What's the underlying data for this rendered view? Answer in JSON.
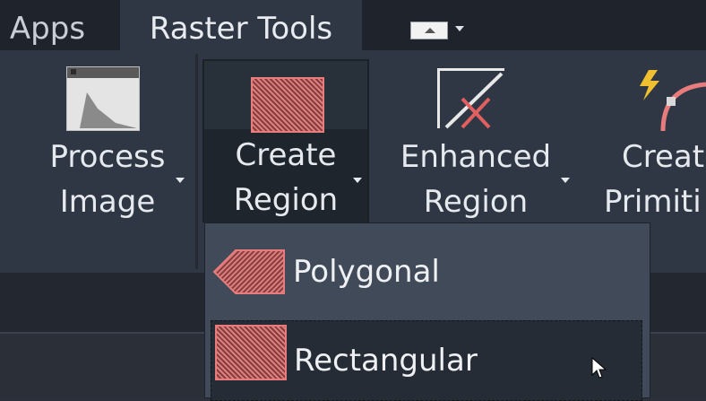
{
  "tabs": [
    {
      "label": "Apps",
      "active": false
    },
    {
      "label": "Raster Tools",
      "active": true
    }
  ],
  "quick_access": {
    "icon": "eject-dropdown-icon"
  },
  "ribbon": {
    "process_image": {
      "line1": "Process",
      "line2": "Image",
      "icon": "histogram-icon"
    },
    "create_region": {
      "line1": "Create",
      "line2": "Region",
      "icon": "region-fill-icon"
    },
    "enhanced_region": {
      "line1": "Enhanced",
      "line2": "Region",
      "icon": "enhanced-region-icon"
    },
    "create_primitive": {
      "line1": "Creat",
      "line2": "Primiti",
      "icon": "create-primitive-icon"
    }
  },
  "dropdown": {
    "items": [
      {
        "label": "Polygonal",
        "icon": "polygon-region-icon"
      },
      {
        "label": "Rectangular",
        "icon": "rectangle-region-icon",
        "hovered": true
      }
    ]
  },
  "colors": {
    "tabbar": "#1f242c",
    "ribbon": "#2f3744",
    "region_fill": "#b05050",
    "region_border": "#e87c7c",
    "dropdown": "#414a59"
  }
}
